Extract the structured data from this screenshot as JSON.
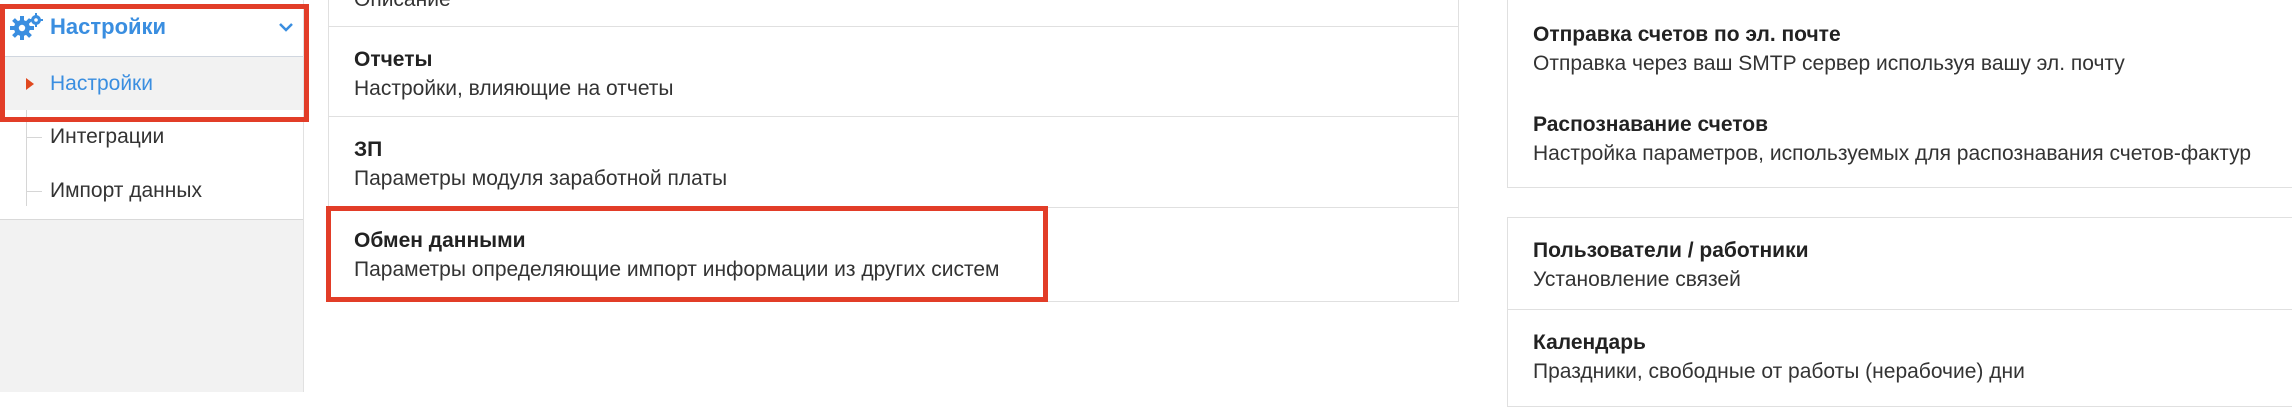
{
  "sidebar": {
    "header_label": "Настройки",
    "items": [
      {
        "label": "Настройки"
      },
      {
        "label": "Интеграции"
      },
      {
        "label": "Импорт данных"
      }
    ]
  },
  "middle": {
    "top_partial": "Описание",
    "rows": [
      {
        "title": "Отчеты",
        "desc": "Настройки, влияющие на отчеты"
      },
      {
        "title": "ЗП",
        "desc": "Параметры модуля заработной платы"
      },
      {
        "title": "Обмен данными",
        "desc": "Параметры определяющие импорт информации из других систем"
      }
    ]
  },
  "right": {
    "group1": [
      {
        "title": "Отправка счетов по эл. почте",
        "desc": "Отправка через ваш SMTP сервер используя вашу эл. почту"
      },
      {
        "title": "Распознавание счетов",
        "desc": "Настройка параметров, используемых для распознавания счетов-фактур"
      }
    ],
    "group2": [
      {
        "title": "Пользователи / работники",
        "desc": "Установление связей"
      },
      {
        "title": "Календарь",
        "desc": "Праздники, свободные от работы (нерабочие) дни"
      }
    ]
  },
  "colors": {
    "accent": "#3a8ee0",
    "highlight": "#e23d28"
  }
}
